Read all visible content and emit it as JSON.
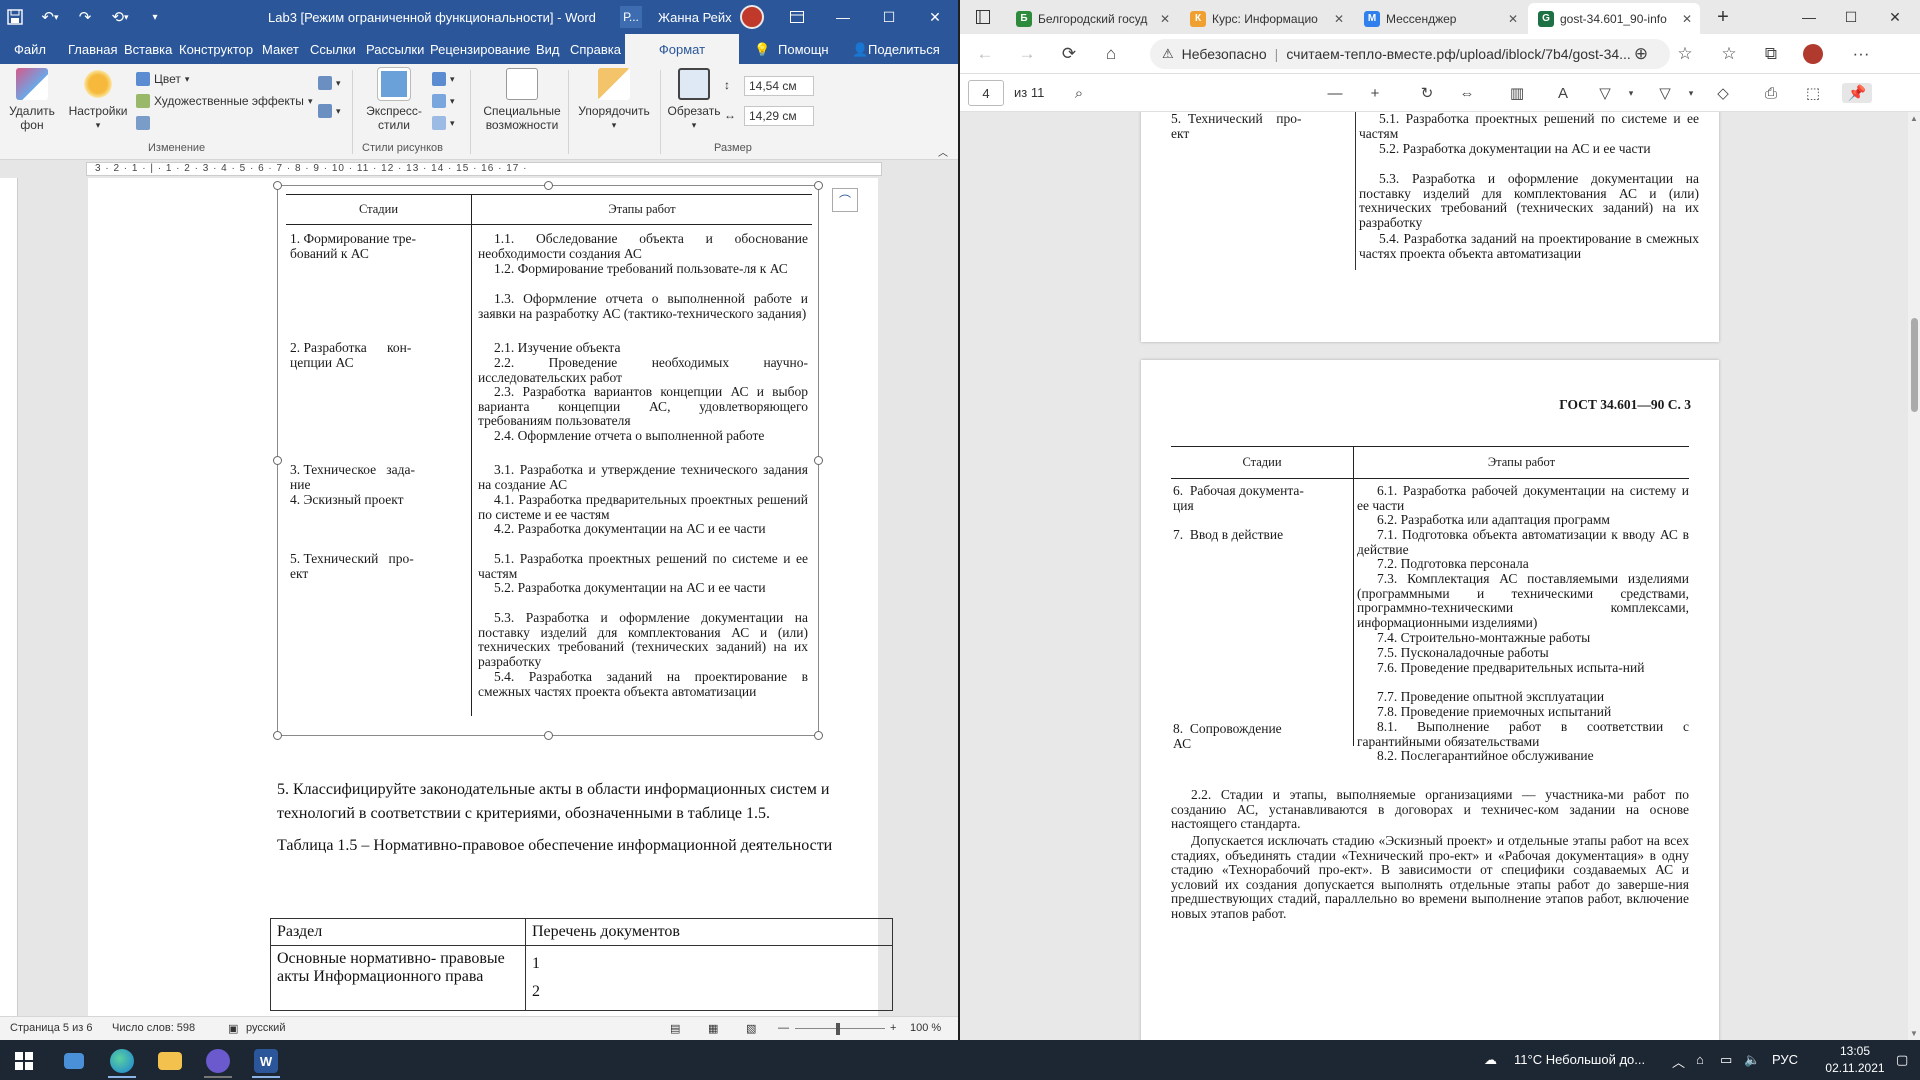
{
  "word": {
    "title": "Lab3 [Режим ограниченной функциональности]  -  Word",
    "search_short": "Р...",
    "user": "Жанна Рейх",
    "tabs": [
      "Файл",
      "Главная",
      "Вставка",
      "Конструктор",
      "Макет",
      "Ссылки",
      "Рассылки",
      "Рецензирование",
      "Вид",
      "Справка"
    ],
    "active_tab": "Формат",
    "help": "Помощн",
    "share": "Поделиться",
    "ribbon": {
      "remove_bg": [
        "Удалить",
        "фон"
      ],
      "corrections": "Настройки",
      "color": "Цвет",
      "artistic": "Художественные эффекты",
      "group_change": "Изменение",
      "express_styles": [
        "Экспресс-",
        "стили"
      ],
      "group_styles": "Стили рисунков",
      "special": [
        "Специальные",
        "возможности"
      ],
      "arrange": "Упорядочить",
      "crop": "Обрезать",
      "height": "14,54 см",
      "width": "14,29 см",
      "group_size": "Размер"
    },
    "ruler": "3 · 2 · 1 · | · 1 · 2 · 3 · 4 · 5 · 6 · 7 · 8 · 9 · 10 · 11 · 12 · 13 · 14 · 15 · 16 · 17 ·",
    "embedded_gost": {
      "header_stages": "Стадии",
      "header_steps": "Этапы работ",
      "stages": [
        "1. Формирование тре-\nбований к АС",
        "2. Разработка      кон-\nцепции АС",
        "3. Техническое   зада-\nние",
        "4. Эскизный проект",
        "5. Технический   про-\nект"
      ],
      "steps": [
        "1.1. Обследование объекта и обоснование необходимости создания АС",
        "1.2. Формирование требований пользовате-ля к АС",
        "1.3. Оформление отчета о выполненной работе и заявки на разработку АС (тактико-технического задания)",
        "2.1. Изучение объекта",
        "2.2. Проведение необходимых научно-исследовательских работ",
        "2.3. Разработка вариантов концепции АС и выбор варианта концепции АС, удовлетворяющего требованиям пользователя",
        "2.4. Оформление отчета о выполненной работе",
        "3.1. Разработка и утверждение технического задания на создание АС",
        "4.1. Разработка предварительных проектных решений по системе и ее частям",
        "4.2. Разработка документации на АС и ее части",
        "5.1. Разработка проектных решений по системе и ее частям",
        "5.2. Разработка документации на АС и ее части",
        "5.3. Разработка и оформление документации на поставку изделий для комплектования АС и (или) технических требований (технических заданий) на их разработку",
        "5.4. Разработка заданий на проектирование в смежных частях проекта объекта автоматизации"
      ]
    },
    "body_text": [
      "5. Классифицируйте законодательные акты в области информационных систем и технологий в соответствии с критериями, обозначенными в таблице 1.5.",
      "Таблица 1.5 – Нормативно-правовое обеспечение информационной деятельности"
    ],
    "table": {
      "headers": [
        "Раздел",
        "Перечень документов"
      ],
      "row1_section": "Основные нормативно- правовые акты Информационного права",
      "row1_items": [
        "1",
        "2"
      ]
    },
    "status": {
      "page": "Страница 5 из 6",
      "words": "Число слов: 598",
      "lang": "русский",
      "zoom": "100 %"
    }
  },
  "edge": {
    "tabs": [
      {
        "title": "Белгородский госуд",
        "color": "#2e8b3d",
        "glyph": "Б"
      },
      {
        "title": "Курс: Информацио",
        "color": "#f0a030",
        "glyph": "К"
      },
      {
        "title": "Мессенджер",
        "color": "#2f80ed",
        "glyph": "М"
      },
      {
        "title": "gost-34.601_90-info",
        "color": "#1e7145",
        "glyph": "G",
        "active": true
      }
    ],
    "not_secure": "Небезопасно",
    "url": "считаем-тепло-вместе.рф/upload/iblock/7b4/gost-34...",
    "pdf_page": "4",
    "pdf_total": "из 11",
    "page_top": {
      "stage": "5.  Технический    про-\nект",
      "steps": [
        "5.1. Разработка проектных решений по системе и ее частям",
        "5.2. Разработка документации на АС и ее части",
        "5.3. Разработка и оформление документации на поставку изделий для комплектования АС и (или) технических требований (технических заданий) на их разработку",
        "5.4. Разработка заданий на проектирование в смежных частях проекта объекта автоматизации"
      ]
    },
    "page_next": {
      "running_header": "ГОСТ 34.601—90 С. 3",
      "header_stages": "Стадии",
      "header_steps": "Этапы работ",
      "stages": [
        "6.  Рабочая документа-\nция",
        "7.  Ввод в действие",
        "8.  Сопровождение\nАС"
      ],
      "steps": [
        "6.1. Разработка рабочей документации на систему и ее части",
        "6.2. Разработка или адаптация программ",
        "7.1. Подготовка объекта автоматизации к вводу АС в действие",
        "7.2. Подготовка персонала",
        "7.3. Комплектация АС поставляемыми изделиями (программными и техническими средствами, программно-техническими комплексами, информационными изделиями)",
        "7.4. Строительно-монтажные работы",
        "7.5. Пусконаладочные работы",
        "7.6. Проведение предварительных испыта-ний",
        "7.7. Проведение опытной эксплуатации",
        "7.8. Проведение приемочных испытаний",
        "8.1. Выполнение работ в соответствии с гарантийными обязательствами",
        "8.2. Послегарантийное обслуживание"
      ],
      "para1": "2.2. Стадии и этапы, выполняемые организациями — участника-ми работ по созданию АС, устанавливаются в договорах и техничес-ком задании на основе настоящего стандарта.",
      "para2": "Допускается исключать стадию «Эскизный проект» и отдельные этапы работ на всех стадиях, объединять стадии «Технический про-ект» и «Рабочая документация» в одну стадию «Технорабочий про-ект». В зависимости от специфики создаваемых АС и условий их создания допускается выполнять отдельные этапы работ до заверше-ния предшествующих стадий, параллельно во времени выполнение этапов работ, включение новых этапов работ."
    }
  },
  "taskbar": {
    "weather": "11°C  Небольшой до...",
    "lang": "РУС",
    "time": "13:05",
    "date": "02.11.2021"
  }
}
